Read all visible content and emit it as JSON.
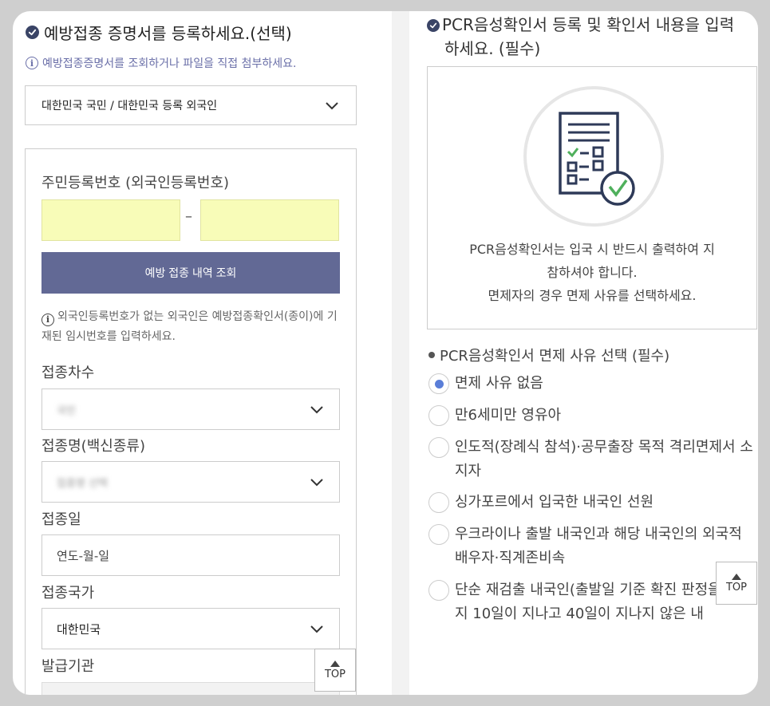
{
  "vaccine": {
    "title": "예방접종 증명서를 등록하세요.(선택)",
    "hint": "예방접종증명서를 조회하거나 파일을 직접 첨부하세요.",
    "nationality_select": "대한민국 국민 / 대한민국 등록 외국인",
    "id_label": "주민등록번호 (외국인등록번호)",
    "id_separator": "–",
    "query_button": "예방 접종 내역 조회",
    "note": "외국인등록번호가 없는 외국인은 예방접종확인서(종이)에 기재된 임시번호를 입력하세요.",
    "dose_label": "접종차수",
    "dose_value": "국민",
    "vaccine_name_label": "접종명(백신종류)",
    "vaccine_name_value": "접종명 선택",
    "date_label": "접종일",
    "date_placeholder": "연도-월-일",
    "country_label": "접종국가",
    "country_value": "대한민국",
    "issuer_label": "발급기관"
  },
  "pcr": {
    "title_line1": "PCR음성확인서 등록 및 확인서 내용을 입력",
    "title_line2": "하세요. (필수)",
    "message_line1": "PCR음성확인서는 입국 시 반드시 출력하여 지",
    "message_line2": "참하셔야 합니다.",
    "message_line3": "면제자의 경우 면제 사유를 선택하세요.",
    "exempt_title": "PCR음성확인서 면제 사유 선택 (필수)",
    "options": [
      "면제 사유 없음",
      "만6세미만 영유아",
      "인도적(장례식 참석)·공무출장 목적 격리면제서 소지자",
      "싱가포르에서 입국한 내국인 선원",
      "우크라이나 출발 내국인과 해당 내국인의 외국적 배우자·직계존비속",
      "단순 재검출 내국인(출발일 기준 확진 판정을 받은지 10일이 지나고 40일이 지나지 않은 내"
    ],
    "selected_index": 0
  },
  "top_button": {
    "label": "TOP"
  },
  "colors": {
    "accent": "#626995",
    "id_input_bg": "#f8fcb8",
    "radio_selected": "#5a7ed8",
    "hint": "#6a6fa8"
  }
}
